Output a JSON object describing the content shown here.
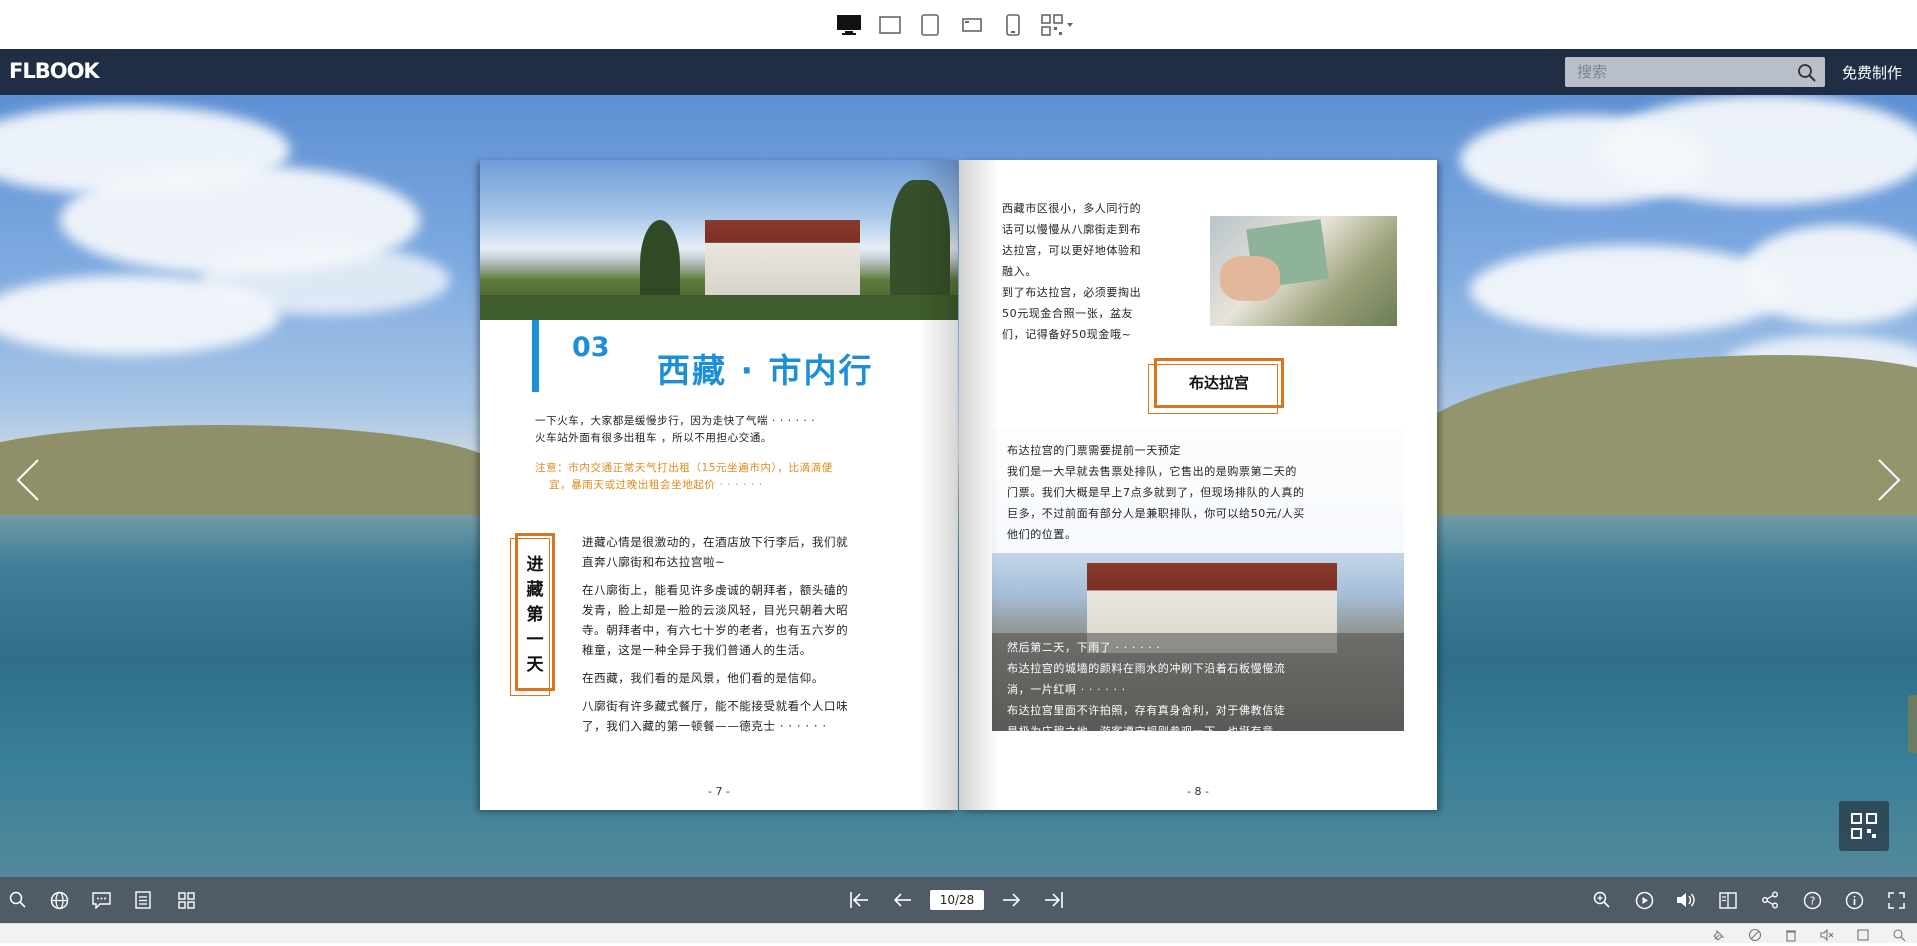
{
  "header": {
    "logo": "FLBOOK",
    "search_placeholder": "搜索",
    "free_make": "免费制作"
  },
  "device_modes": [
    "desktop-icon",
    "tablet-landscape-icon",
    "tablet-portrait-icon",
    "phone-landscape-icon",
    "phone-portrait-icon",
    "qr-code-icon"
  ],
  "book": {
    "left": {
      "section_number": "03",
      "section_title": "西藏 · 市内行",
      "intro_lines": [
        "一下火车，大家都是缓慢步行，因为走快了气喘 · · · · · ·",
        "火车站外面有很多出租车 ，所以不用担心交通。"
      ],
      "note_lines": [
        "注意：市内交通正常天气打出租（15元坐遍市内），比滴滴便",
        "宜，暴雨天或过晚出租会坐地起价 · · · · · ·"
      ],
      "vertical_title": [
        "进",
        "藏",
        "第",
        "一",
        "天"
      ],
      "body_paragraphs": [
        [
          "进藏心情是很激动的，在酒店放下行李后，我们就",
          "直奔八廓街和布达拉宫啦~"
        ],
        [
          "在八廓街上，能看见许多虔诚的朝拜者，额头磕的",
          "发青，脸上却是一脸的云淡风轻，目光只朝着大昭",
          "寺。朝拜者中，有六七十岁的老者，也有五六岁的",
          "稚童，这是一种全异于我们普通人的生活。"
        ],
        [
          "在西藏，我们看的是风景，他们看的是信仰。"
        ],
        [
          "八廓街有许多藏式餐厅，能不能接受就看个人口味",
          "了，我们入藏的第一顿餐——德克士 · · · · · ·"
        ]
      ],
      "page_number": "- 7 -"
    },
    "right": {
      "top_lines": [
        "西藏市区很小，多人同行的",
        "话可以慢慢从八廓街走到布",
        "达拉宫，可以更好地体验和",
        "融入。",
        "到了布达拉宫，必须要掏出",
        "50元现金合照一张，盆友",
        "们，记得备好50现金哦~"
      ],
      "badge": "布达拉宫",
      "ticket_lines": [
        "布达拉宫的门票需要提前一天预定",
        "我们是一大早就去售票处排队，它售出的是购票第二天的",
        "门票。我们大概是早上7点多就到了，但现场排队的人真的",
        "巨多，不过前面有部分人是兼职排队，你可以给50元/人买",
        "他们的位置。"
      ],
      "caption_lines": [
        "然后第二天，下雨了 · · · · · ·",
        "布达拉宫的城墙的颜料在雨水的冲刷下沿着石板慢慢流",
        "淌，一片红啊 · · · · · ·",
        "布达拉宫里面不许拍照，存有真身舍利，对于佛教信徒",
        "是极为庄穆之地，游客遵守规则参观一下，也挺有意"
      ],
      "page_number": "- 8 -"
    }
  },
  "toolbar": {
    "page_indicator": "10/28",
    "left_icons": [
      "search-icon",
      "globe-icon",
      "comment-icon",
      "table-of-contents-icon",
      "thumbnails-icon"
    ],
    "center_icons": [
      "first-page-icon",
      "previous-page-icon",
      "next-page-icon",
      "last-page-icon"
    ],
    "right_icons": [
      "zoom-in-icon",
      "autoplay-icon",
      "sound-icon",
      "bookmark-icon",
      "share-icon",
      "help-icon",
      "info-icon",
      "fullscreen-icon"
    ]
  },
  "colors": {
    "header_bg": "#1f2d45",
    "accent_blue": "#1d8fd8",
    "accent_orange": "#d9741f"
  }
}
